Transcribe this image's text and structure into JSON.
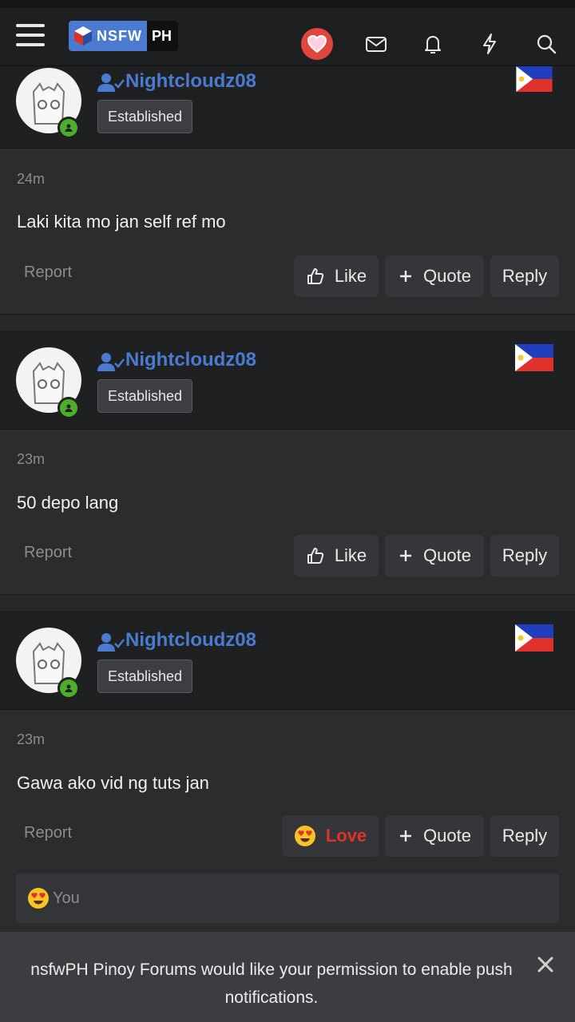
{
  "header": {
    "logo_left": "NSFW",
    "logo_right": "PH",
    "icons": [
      "menu-icon",
      "heart-icon",
      "mail-icon",
      "bell-icon",
      "lightning-icon",
      "search-icon"
    ]
  },
  "posts": [
    {
      "username": "Nightcloudz08",
      "badge": "Established",
      "time": "24m",
      "text": "Laki kita mo jan self ref mo",
      "report": "Report",
      "like": "Like",
      "quote": "Quote",
      "reply": "Reply"
    },
    {
      "username": "Nightcloudz08",
      "badge": "Established",
      "time": "23m",
      "text": "50 depo lang",
      "report": "Report",
      "like": "Like",
      "quote": "Quote",
      "reply": "Reply"
    },
    {
      "username": "Nightcloudz08",
      "badge": "Established",
      "time": "23m",
      "text": "Gawa ako vid ng tuts jan",
      "report": "Report",
      "like": "Love",
      "quote": "Quote",
      "reply": "Reply",
      "reactions_label": "You"
    }
  ],
  "notification": {
    "message": "nsfwPH Pinoy Forums would like your permission to enable push notifications."
  },
  "colors": {
    "accent": "#4a7bd0",
    "love": "#e0312d",
    "online": "#4caf2a"
  }
}
